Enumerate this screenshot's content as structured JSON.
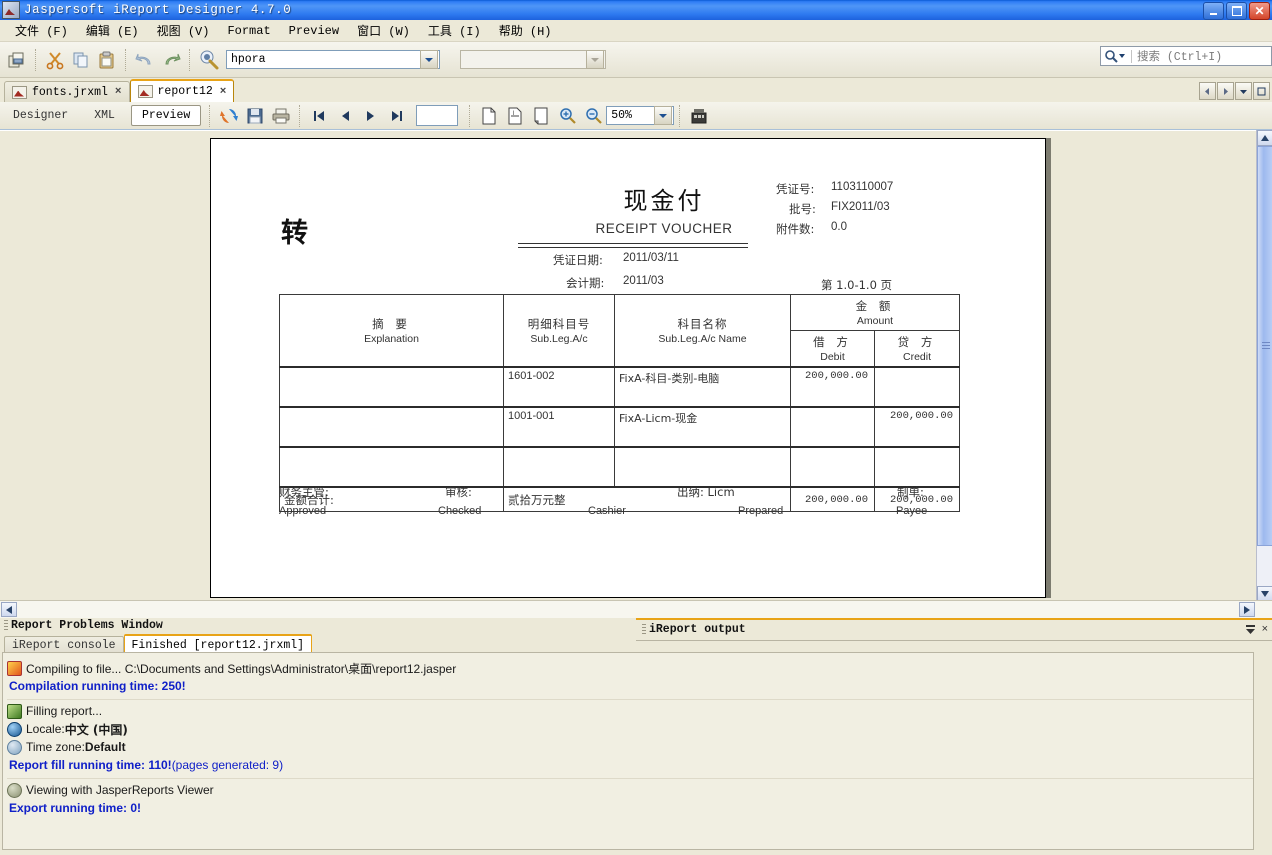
{
  "window": {
    "title": "Jaspersoft iReport Designer 4.7.0",
    "minimize_label": "",
    "maximize_label": "",
    "close_label": "×"
  },
  "menubar": {
    "items": [
      {
        "label": "文件 (F)",
        "name": "menu-file"
      },
      {
        "label": "编辑 (E)",
        "name": "menu-edit"
      },
      {
        "label": "视图 (V)",
        "name": "menu-view"
      },
      {
        "label": "Format",
        "name": "menu-format"
      },
      {
        "label": "Preview",
        "name": "menu-preview"
      },
      {
        "label": "窗口 (W)",
        "name": "menu-window"
      },
      {
        "label": "工具 (I)",
        "name": "menu-tools"
      },
      {
        "label": "帮助 (H)",
        "name": "menu-help"
      }
    ]
  },
  "toolbar": {
    "icons": [
      "new-file-icon",
      "cut-icon",
      "copy-icon",
      "paste-icon",
      "undo-icon",
      "redo-icon",
      "run-report-icon"
    ],
    "connection_value": "hpora",
    "second_combo_value": ""
  },
  "search": {
    "placeholder": "搜索  (Ctrl+I)",
    "icon": "search-icon"
  },
  "doctabs": {
    "tabs": [
      {
        "label": "fonts.jrxml",
        "close": "×",
        "active": false
      },
      {
        "label": "report12",
        "close": "×",
        "active": true
      }
    ]
  },
  "previewbar": {
    "designer_label": "Designer",
    "xml_label": "XML",
    "preview_label": "Preview",
    "page_field_value": "",
    "zoom_value": "50%",
    "icons": [
      "refresh-icon",
      "save-icon",
      "print-icon",
      "first-page-icon",
      "previous-page-icon",
      "next-page-icon",
      "last-page-icon",
      "actual-size-icon",
      "fit-page-icon",
      "fit-width-icon",
      "zoom-in-icon",
      "zoom-out-icon",
      "export-icon"
    ]
  },
  "report": {
    "stamp": "转",
    "title_cn": "现金付",
    "title_en": "RECEIPT VOUCHER",
    "date_label": "凭证日期:",
    "date_value": "2011/03/11",
    "period_label": "会计期:",
    "period_value": "2011/03",
    "voucher_no_label": "凭证号:",
    "voucher_no_value": "1103110007",
    "batch_label": "批号:",
    "batch_value": "FIX2011/03",
    "attach_label": "附件数:",
    "attach_value": "0.0",
    "page_indicator": "第 1.0-1.0 页",
    "table": {
      "headers": {
        "explanation_cn": "摘      要",
        "explanation_en": "Explanation",
        "subleg_cn": "明细科目号",
        "subleg_en": "Sub.Leg.A/c",
        "subleg_name_cn": "科目名称",
        "subleg_name_en": "Sub.Leg.A/c Name",
        "amount_cn": "金      额",
        "amount_en": "Amount",
        "debit_cn": "借    方",
        "debit_en": "Debit",
        "credit_cn": "贷    方",
        "credit_en": "Credit"
      },
      "rows": [
        {
          "explanation": "",
          "subleg": "1601-002",
          "subleg_name": "FixA-科目-类别-电脑",
          "debit": "200,000.00",
          "credit": ""
        },
        {
          "explanation": "",
          "subleg": "1001-001",
          "subleg_name": "FixA-Licm-现金",
          "debit": "",
          "credit": "200,000.00"
        },
        {
          "explanation": "",
          "subleg": "",
          "subleg_name": "",
          "debit": "",
          "credit": ""
        }
      ],
      "total": {
        "label": "金额合计:",
        "words": "贰拾万元整",
        "debit": "200,000.00",
        "credit": "200,000.00"
      }
    },
    "signatures": [
      {
        "cn": "财务主管:",
        "en": "Approved"
      },
      {
        "cn": "审核:",
        "en": "Checked"
      },
      {
        "cn": "",
        "en": "Cashier"
      },
      {
        "cn": "出纳: Licm",
        "en": "Prepared"
      },
      {
        "cn": "制单:",
        "en": "Payee"
      }
    ]
  },
  "bottom": {
    "left_panel_title": "Report Problems Window",
    "right_panel_title": "iReport output",
    "tabs": [
      {
        "label": "iReport console",
        "active": false
      },
      {
        "label": "Finished [report12.jrxml]",
        "active": true
      }
    ],
    "console_groups": [
      {
        "lines": [
          {
            "icon": "compile-icon",
            "text": "Compiling to file... C:\\Documents and Settings\\Administrator\\桌面\\report12.jasper",
            "style": "plain"
          },
          {
            "icon": "",
            "text": "Compilation running time: 250!",
            "style": "blue"
          }
        ]
      },
      {
        "lines": [
          {
            "icon": "fill-icon",
            "text": "Filling report...",
            "style": "plain"
          },
          {
            "icon": "locale-icon",
            "text": "Locale: 中文 (中国)",
            "style": "plain-bold-value",
            "label": "Locale: ",
            "value": "中文 (中国)"
          },
          {
            "icon": "timezone-icon",
            "text": "Time zone: Default",
            "style": "plain-bold-value",
            "label": "Time zone: ",
            "value": "Default"
          },
          {
            "icon": "",
            "text": "Report fill running time: 110! (pages generated: 9)",
            "style": "blue-mixed",
            "bold_part": "Report fill running time: 110!",
            "soft_part": " (pages generated: 9)"
          }
        ]
      },
      {
        "lines": [
          {
            "icon": "view-icon",
            "text": "Viewing with JasperReports Viewer",
            "style": "plain"
          },
          {
            "icon": "",
            "text": "Export running time: 0!",
            "style": "blue"
          }
        ]
      }
    ],
    "panel_controls": {
      "minimize": "≡",
      "close": "×"
    }
  },
  "colors": {
    "title_bar": "#2f7df5",
    "chrome": "#ece9d8",
    "accent_orange": "#e8a317",
    "console_blue": "#1020c8",
    "page_white": "#ffffff"
  }
}
